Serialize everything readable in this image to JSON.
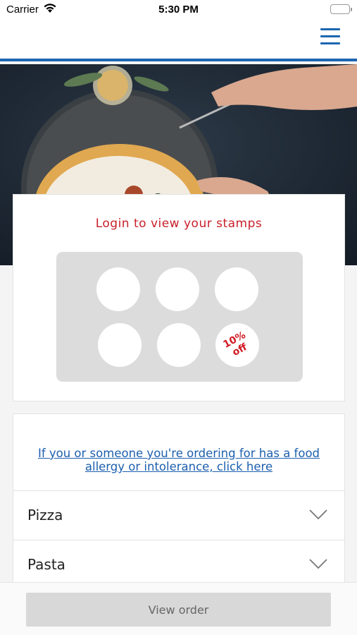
{
  "status_bar": {
    "carrier": "Carrier",
    "time": "5:30 PM"
  },
  "stamps": {
    "title": "Login to view your stamps",
    "reward_line1": "10%",
    "reward_line2": "off"
  },
  "menu": {
    "allergy_link": "If you or someone you're ordering for has a food allergy or intolerance, click here",
    "categories": [
      {
        "label": "Pizza"
      },
      {
        "label": "Pasta"
      }
    ]
  },
  "footer": {
    "view_order_label": "View order"
  },
  "colors": {
    "brand_blue": "#1c66b1",
    "title_red": "#c8202a",
    "link_blue": "#1c5fae"
  }
}
